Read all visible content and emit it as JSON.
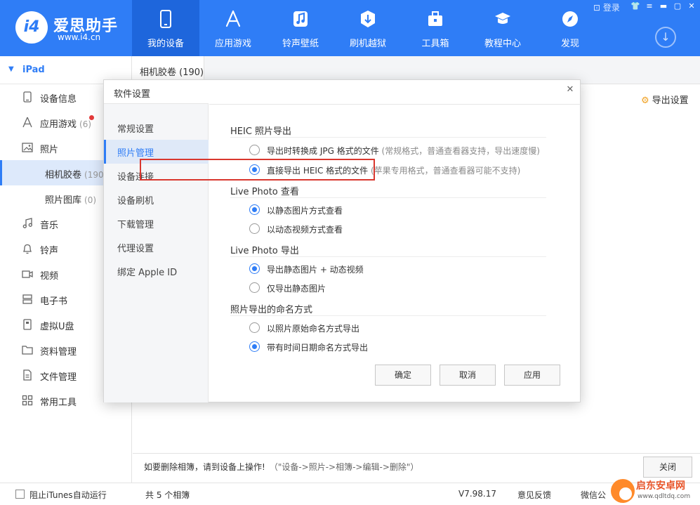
{
  "app": {
    "logo_mark": "i4",
    "name": "爱思助手",
    "url": "www.i4.cn"
  },
  "window": {
    "login": "登录",
    "icons": [
      "shirt-icon",
      "menu-icon",
      "minimize-icon",
      "maximize-icon",
      "close-icon"
    ]
  },
  "nav": [
    {
      "label": "我的设备",
      "icon": "phone-icon",
      "active": true
    },
    {
      "label": "应用游戏",
      "icon": "app-store-icon"
    },
    {
      "label": "铃声壁纸",
      "icon": "music-icon"
    },
    {
      "label": "刷机越狱",
      "icon": "box-icon"
    },
    {
      "label": "工具箱",
      "icon": "toolbox-icon"
    },
    {
      "label": "教程中心",
      "icon": "graduation-cap-icon"
    },
    {
      "label": "发现",
      "icon": "compass-icon"
    }
  ],
  "sidebar": {
    "device": "iPad",
    "items": [
      {
        "label": "设备信息",
        "icon": "device-icon"
      },
      {
        "label": "应用游戏",
        "count": "(6)",
        "icon": "app-icon",
        "badge": true
      },
      {
        "label": "照片",
        "icon": "photo-icon"
      },
      {
        "label": "相机胶卷",
        "count": "(190)",
        "sub": true,
        "active": true
      },
      {
        "label": "照片图库",
        "count": "(0)",
        "sub": true
      },
      {
        "label": "音乐",
        "icon": "music-note-icon"
      },
      {
        "label": "铃声",
        "icon": "bell-icon"
      },
      {
        "label": "视频",
        "icon": "video-icon"
      },
      {
        "label": "电子书",
        "icon": "book-icon"
      },
      {
        "label": "虚拟U盘",
        "icon": "usb-icon"
      },
      {
        "label": "资料管理",
        "icon": "folder-icon"
      },
      {
        "label": "文件管理",
        "icon": "file-icon"
      },
      {
        "label": "常用工具",
        "icon": "grid-icon"
      }
    ]
  },
  "main": {
    "tab": "相机胶卷 (190)",
    "export_settings": "导出设置",
    "hint": "如要删除相簿，请到设备上操作!",
    "hint_path": "（\"设备->照片->相簿->编辑->删除\"）",
    "close": "关闭"
  },
  "statusbar": {
    "block_itunes": "阻止iTunes自动运行",
    "album_count": "共 5 个相簿",
    "version": "V7.98.17",
    "feedback": "意见反馈",
    "wechat": "微信公"
  },
  "dialog": {
    "title": "软件设置",
    "nav": [
      "常规设置",
      "照片管理",
      "设备连接",
      "设备刷机",
      "下载管理",
      "代理设置",
      "绑定 Apple ID"
    ],
    "active_nav": 1,
    "groups": [
      {
        "title": "HEIC 照片导出",
        "options": [
          {
            "label": "导出时转换成 JPG 格式的文件",
            "note": "(常规格式，普通查看器支持，导出速度慢)",
            "checked": false
          },
          {
            "label": "直接导出 HEIC 格式的文件",
            "note": "(苹果专用格式，普通查看器可能不支持)",
            "checked": true
          }
        ]
      },
      {
        "title": "Live Photo 查看",
        "options": [
          {
            "label": "以静态图片方式查看",
            "checked": true
          },
          {
            "label": "以动态视频方式查看",
            "checked": false
          }
        ]
      },
      {
        "title": "Live Photo 导出",
        "options": [
          {
            "label": "导出静态图片 + 动态视频",
            "checked": true
          },
          {
            "label": "仅导出静态图片",
            "checked": false
          }
        ]
      },
      {
        "title": "照片导出的命名方式",
        "options": [
          {
            "label": "以照片原始命名方式导出",
            "checked": false
          },
          {
            "label": "带有时间日期命名方式导出",
            "checked": true
          }
        ]
      }
    ],
    "buttons": {
      "ok": "确定",
      "cancel": "取消",
      "apply": "应用"
    }
  },
  "watermark": {
    "name": "启东安卓网",
    "url": "www.qdltdq.com"
  },
  "colors": {
    "accent": "#2f7df6",
    "header": "#2f7df6",
    "highlight": "#d9372e"
  }
}
